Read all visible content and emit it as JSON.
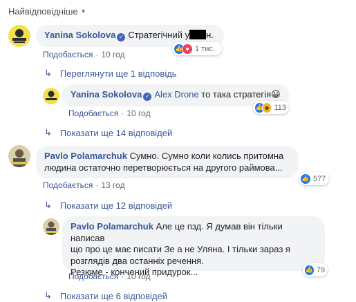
{
  "sort_label": "Найвідповідніше",
  "comments": [
    {
      "author": "Yanina Sokolova",
      "text": "Стратегічний у",
      "text_tail": "н.",
      "action_label": "Подобається",
      "time": "10 год",
      "reaction_count": "1 тис.",
      "reaction_icons": [
        "like-icon",
        "love-icon"
      ]
    },
    {
      "author": "Yanina Sokolova",
      "mention": "Alex Drone",
      "text": "то така стратегія",
      "emoji": "😀",
      "action_label": "Подобається",
      "time": "10 год",
      "reaction_count": "113",
      "reaction_icons": [
        "like-icon",
        "haha-icon"
      ]
    },
    {
      "author": "Pavlo Polamarchuk",
      "text_line1": "Сумно. Сумно коли колись притомна",
      "text_line2": "людина остаточно перетворюється на другого раймова...",
      "action_label": "Подобається",
      "time": "13 год",
      "reaction_count": "577",
      "reaction_icons": [
        "like-icon"
      ]
    },
    {
      "author": "Pavlo Polamarchuk",
      "text_line1": "Але це пзд. Я думав він тільки написав",
      "text_line2": "що про це має писати Зе а не Уляна. І тільки зараз я",
      "text_line3": "розглядів два останніх речення.",
      "text_line4": "Резюме - кончений придурок...",
      "action_label": "Подобається",
      "time": "10 год",
      "reaction_count": "79",
      "reaction_icons": [
        "like-icon"
      ]
    }
  ],
  "more_links": {
    "view_one_more": "Переглянути ще 1 відповідь",
    "show_14": "Показати ще 14 відповідей",
    "show_12": "Показати ще 12 відповідей",
    "show_6": "Показати ще 6 відповідей"
  },
  "colors": {
    "link": "#385898",
    "bubble": "#f2f3f5",
    "like": "#1877f2",
    "love": "#f33e58",
    "haha": "#f7b125"
  }
}
